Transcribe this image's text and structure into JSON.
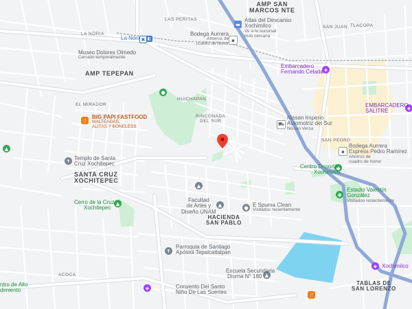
{
  "areas": {
    "amp_san_marcos_1": "AMP SAN",
    "amp_san_marcos_2": "MARCOS NTE",
    "amp_tepepan": "AMP TEPEPAN",
    "santa_cruz_1": "SANTA CRUZ",
    "santa_cruz_2": "XOCHITEPEC",
    "hacienda_1": "HACIENDA",
    "hacienda_2": "SAN PABLO",
    "tablas_1": "TABLAS DE",
    "tablas_2": "SAN LORENZO"
  },
  "neighborhoods": {
    "las_peritas": "LAS PERITAS",
    "la_noria": "LA NORIA",
    "el_mirador": "EL MIRADOR",
    "huichapan": "HUICHAPAN",
    "rinconada_1": "RINCONADA",
    "rinconada_2": "DEL SUR",
    "san_juan": "SAN JUAN",
    "tlacopa": "TLACOPA",
    "san_pedro": "SAN PEDRO",
    "acoca": "ACOCA"
  },
  "pois": {
    "atlas": {
      "name_1": "Atlas del Descanso",
      "name_2": "Xochimilco",
      "sub_1": "Ve a tu sucursal",
      "sub_2": "más cercana"
    },
    "bodega1": {
      "name": "Bodega Aurrera",
      "sub_1": "Ahorros de",
      "sub_2": "cuadro de honor"
    },
    "la_noria": {
      "name": "La Noria"
    },
    "museo": {
      "name": "Museo Dolores Olmedo",
      "sub": "Cerrado temporalmente"
    },
    "embarcadero_fc": {
      "name_1": "Embarcadero",
      "name_2": "Fernando Celada"
    },
    "embarcadero_salitre": {
      "name_1": "EMBARCADERO",
      "name_2": "SALITRE"
    },
    "big_papi": {
      "name_1": "BIG PAPI FASTFOOD",
      "sub_1": "MALTEADAS,",
      "sub_2": "ALITAS Y BONELESS"
    },
    "nissan": {
      "name_1": "Nissan Imperio",
      "name_2": "Automotriz del Sur",
      "sub": "Nissan Versa"
    },
    "bodega2": {
      "name_1": "Bodega Aurrera",
      "name_2": "Express Pedro Ramírez",
      "sub_1": "Ahorros de",
      "sub_2": "cuadro de honor"
    },
    "templo": {
      "name_1": "Templo de Santa",
      "name_2": "Cruz Xochitepec"
    },
    "centro_deportivo": {
      "name_1": "Centro Deportivo",
      "name_2": "Xochimilco"
    },
    "estadio": {
      "name_1": "Estadio Valentín",
      "name_2": "González",
      "sub": "Visitados recientemente"
    },
    "cerro": {
      "name_1": "Cerro de la Cruz",
      "name_2": "Xochitepec"
    },
    "facultad": {
      "name_1": "Facultad",
      "name_2": "de Artes y",
      "name_3": "Diseño UNAM"
    },
    "espuma": {
      "name": "E Spuma Clean",
      "sub": "Visitados recientemente"
    },
    "parroquia": {
      "name_1": "Parroquia de Santiago",
      "name_2": "Apóstol Tepalcatlalpan"
    },
    "escuela": {
      "name_1": "Escuela Secundaria",
      "name_2": "Diurna N° 180"
    },
    "convento": {
      "name_1": "Convento Del Santo",
      "name_2": "Niño De Las Suertes"
    },
    "xochimilco": {
      "name": "Xochimilco"
    },
    "centro_alto": {
      "name_1": "ntro de Alto",
      "name_2": "dimiento"
    }
  },
  "colors": {
    "road": "#ffffff",
    "road_edge": "#dadce0",
    "highway": "#8ea8d8",
    "park": "#cfeed6",
    "water": "#7ed3f0",
    "pin": "#ea4335",
    "beige": "#fbf0d1"
  },
  "icons": [
    "metro-icon",
    "store-icon",
    "museum-icon",
    "restaurant-icon",
    "church-icon",
    "park-icon",
    "car-dealer-icon",
    "stadium-icon",
    "university-icon",
    "school-icon",
    "boat-icon",
    "red-location-pin-icon"
  ]
}
